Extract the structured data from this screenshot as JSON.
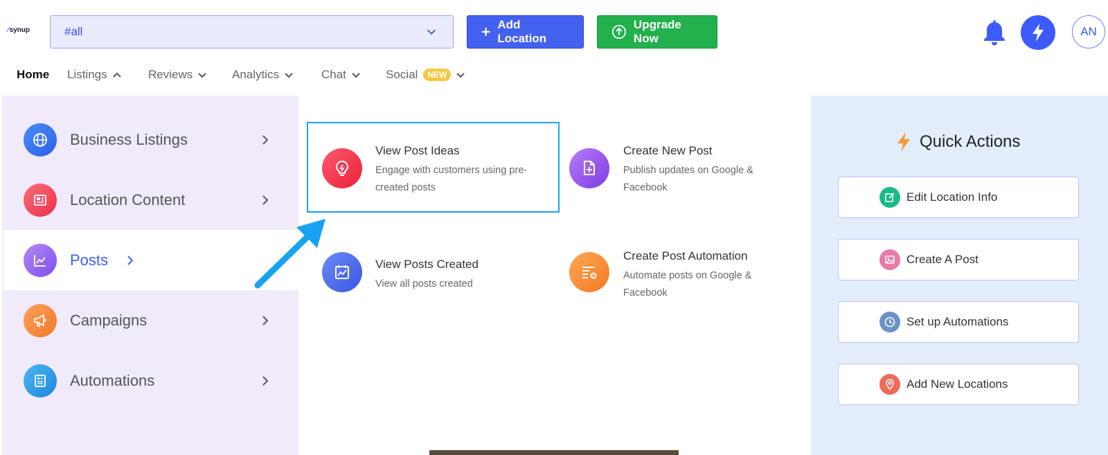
{
  "header": {
    "logo_text": "synup",
    "location_select_value": "#all",
    "add_location_label": "Add Location",
    "upgrade_label": "Upgrade Now",
    "avatar_initials": "AN"
  },
  "nav": {
    "items": [
      {
        "label": "Home"
      },
      {
        "label": "Listings"
      },
      {
        "label": "Reviews"
      },
      {
        "label": "Analytics"
      },
      {
        "label": "Chat"
      },
      {
        "label": "Social"
      }
    ],
    "new_badge": "NEW"
  },
  "left_menu": {
    "items": [
      {
        "label": "Business Listings",
        "icon": "globe-icon",
        "color": "#3b6ff0"
      },
      {
        "label": "Location Content",
        "icon": "newspaper-icon",
        "color": "#f2465a"
      },
      {
        "label": "Posts",
        "icon": "chart-line-icon",
        "color": "#8b5cf6"
      },
      {
        "label": "Campaigns",
        "icon": "megaphone-icon",
        "color": "#f4883a"
      },
      {
        "label": "Automations",
        "icon": "document-list-icon",
        "color": "#2f95e0"
      }
    ]
  },
  "posts_menu": {
    "cards": [
      {
        "title": "View Post Ideas",
        "desc": "Engage with customers using pre-created posts",
        "icon": "lightbulb-icon"
      },
      {
        "title": "Create New Post",
        "desc": "Publish updates on Google & Facebook",
        "icon": "file-plus-icon"
      },
      {
        "title": "View Posts Created",
        "desc": "View all posts created",
        "icon": "calendar-chart-icon"
      },
      {
        "title": "Create Post Automation",
        "desc": "Automate posts on Google & Facebook",
        "icon": "list-gear-icon"
      }
    ]
  },
  "quick_actions": {
    "title": "Quick Actions",
    "buttons": [
      {
        "label": "Edit Location Info",
        "icon": "edit-icon",
        "color": "#19b98a"
      },
      {
        "label": "Create A Post",
        "icon": "image-icon",
        "color": "#e06aa0"
      },
      {
        "label": "Set up Automations",
        "icon": "clock-icon",
        "color": "#5b88c4"
      },
      {
        "label": "Add New Locations",
        "icon": "map-pin-icon",
        "color": "#ec5a4f"
      }
    ]
  },
  "colors": {
    "brand": "#3b5bfd",
    "upgrade": "#22b14c",
    "highlight_border": "#18a2ec",
    "arrow": "#17a3ef"
  }
}
